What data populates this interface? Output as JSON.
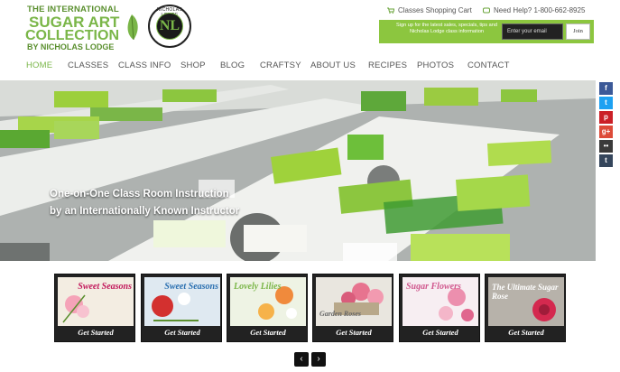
{
  "brand": {
    "logo_line1": "THE INTERNATIONAL",
    "logo_line2": "SUGAR ART",
    "logo_line3": "COLLECTION",
    "logo_line4": "BY NICHOLAS LODGE",
    "badge_monogram": "NL",
    "badge_ring_text": "NICHOLAS LODGE"
  },
  "top_links": {
    "cart_label": "Classes Shopping Cart",
    "help_label": "Need Help? 1-800-662-8925"
  },
  "signup": {
    "text": "Sign up for the latest sales, specials, tips and Nicholas Lodge class information",
    "input_placeholder": "Enter your email",
    "button_label": "Join"
  },
  "nav": {
    "items": [
      {
        "label": "HOME",
        "active": true
      },
      {
        "label": "CLASSES"
      },
      {
        "label": "CLASS INFO"
      },
      {
        "label": "SHOP"
      },
      {
        "label": "BLOG"
      },
      {
        "label": "CRAFTSY"
      },
      {
        "label": "ABOUT US"
      },
      {
        "label": "RECIPES"
      },
      {
        "label": "PHOTOS"
      },
      {
        "label": "CONTACT"
      }
    ]
  },
  "hero": {
    "caption_line1": "One-on-One Class Room Instruction",
    "caption_line2": "by an Internationally Known Instructor"
  },
  "social": [
    {
      "icon": "facebook-icon",
      "glyph": "f",
      "color": "#3b5998"
    },
    {
      "icon": "twitter-icon",
      "glyph": "t",
      "color": "#1da1f2"
    },
    {
      "icon": "pinterest-icon",
      "glyph": "p",
      "color": "#cb2027"
    },
    {
      "icon": "google-plus-icon",
      "glyph": "g+",
      "color": "#dd4b39"
    },
    {
      "icon": "flickr-icon",
      "glyph": "••",
      "color": "#3a3a3a"
    },
    {
      "icon": "tumblr-icon",
      "glyph": "t",
      "color": "#35465c"
    }
  ],
  "thumbnails": [
    {
      "title": "Sweet Seasons",
      "title_color": "#c2185b",
      "bg": "#f3ede2",
      "cta": "Get Started"
    },
    {
      "title": "Sweet Seasons",
      "title_color": "#2a6fb0",
      "bg": "#dfe9f1",
      "cta": "Get Started"
    },
    {
      "title": "Lovely Lilies",
      "title_color": "#7ab648",
      "bg": "#eef3e4",
      "cta": "Get Started"
    },
    {
      "title": "Garden Roses",
      "title_color": "#666666",
      "bg": "#e9e6df",
      "cta": "Get Started"
    },
    {
      "title": "Sugar Flowers",
      "title_color": "#d0588e",
      "bg": "#f7eef2",
      "cta": "Get Started"
    },
    {
      "title": "The Ultimate Sugar Rose",
      "title_color": "#ffffff",
      "bg": "#b7b2aa",
      "cta": "Get Started"
    }
  ],
  "carousel": {
    "prev_glyph": "‹",
    "next_glyph": "›"
  },
  "colors": {
    "accent_green": "#8cc63f",
    "brand_green": "#7ab648"
  }
}
